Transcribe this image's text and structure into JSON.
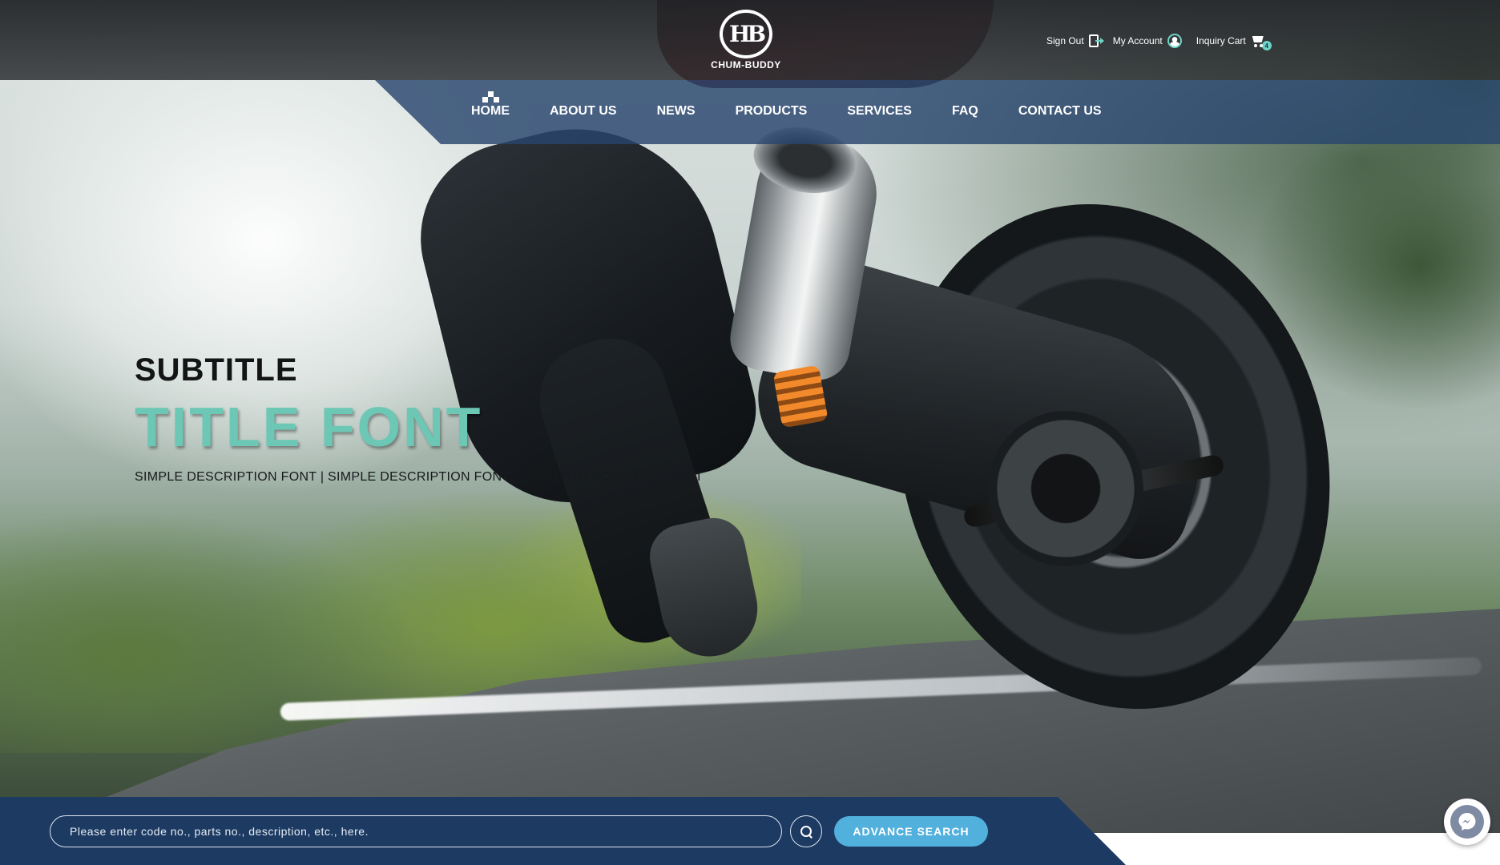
{
  "brand": {
    "name": "CHUM-BUDDY",
    "monogram": "HB"
  },
  "utility_nav": {
    "sign_out": "Sign Out",
    "my_account": "My Account",
    "inquiry_cart": "Inquiry Cart",
    "cart_count": "4"
  },
  "main_nav": {
    "items": [
      {
        "label": "HOME"
      },
      {
        "label": "ABOUT US"
      },
      {
        "label": "NEWS"
      },
      {
        "label": "PRODUCTS"
      },
      {
        "label": "SERVICES"
      },
      {
        "label": "FAQ"
      },
      {
        "label": "CONTACT US"
      }
    ]
  },
  "hero": {
    "subtitle": "SUBTITLE",
    "title": "TITLE FONT",
    "description": "SIMPLE DESCRIPTION FONT | SIMPLE DESCRIPTION FONT | SIMPLE DESCRIPTION FONT"
  },
  "search": {
    "placeholder": "Please enter code no., parts no., description, etc., here.",
    "advance_label": "ADVANCE SEARCH"
  },
  "colors": {
    "accent_teal": "#6cc7b5",
    "nav_blue": "#28466e",
    "search_band": "#1c3a62",
    "button_blue": "#52b0dd"
  },
  "icons": [
    "sign-out-icon",
    "account-icon",
    "cart-icon",
    "home-icon",
    "search-icon",
    "messenger-icon"
  ]
}
